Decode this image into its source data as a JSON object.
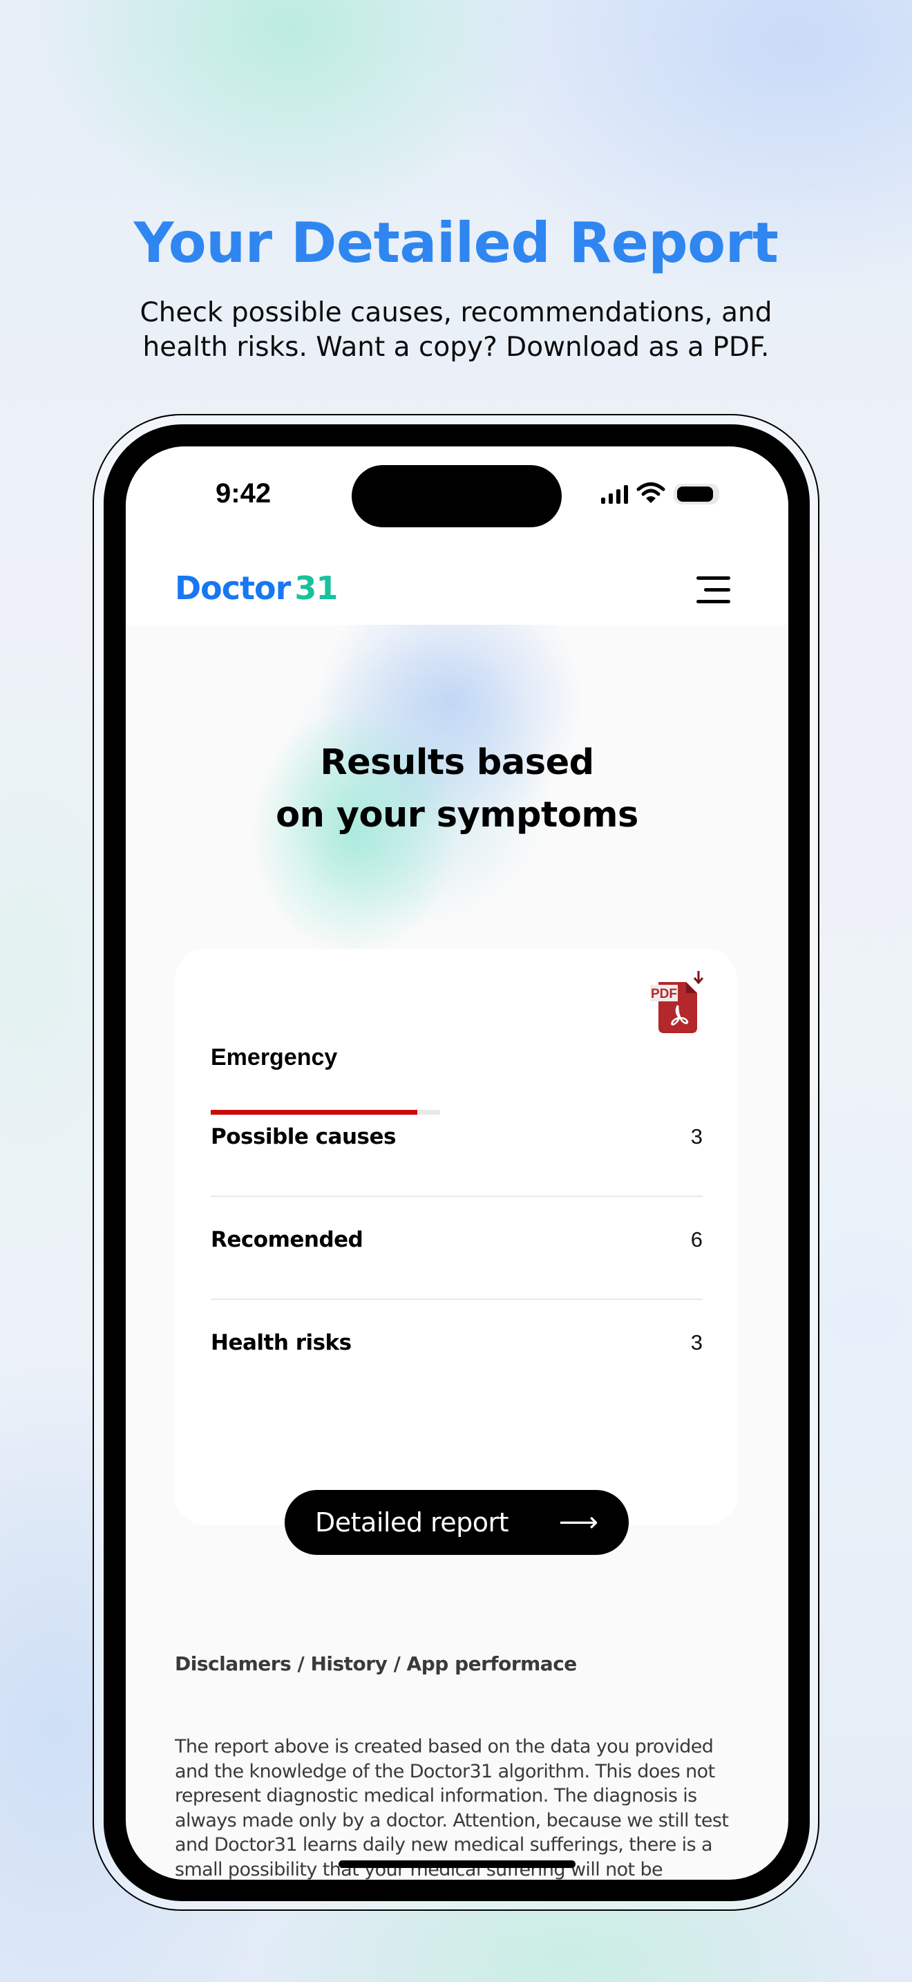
{
  "page": {
    "title": "Your Detailed Report",
    "subtitle_lines": [
      "Check possible causes, recommendations, and",
      "health risks. Want a copy? Download as a PDF."
    ],
    "accent_color": "#2f86f0"
  },
  "status_bar": {
    "time": "9:42",
    "icons": [
      "cellular-signal-icon",
      "wifi-icon",
      "battery-icon"
    ]
  },
  "header": {
    "logo_word": "Doctor",
    "logo_number": "31",
    "logo_colors": {
      "word": "#1877f2",
      "number": "#18c19b"
    },
    "menu_icon": "hamburger-menu-icon"
  },
  "results": {
    "title_lines": [
      "Results based",
      "on your symptoms"
    ]
  },
  "card": {
    "pdf_icon": "pdf-download-icon",
    "pdf_label": "PDF",
    "severity": {
      "label": "Emergency",
      "level_fraction": 0.9,
      "color": "#cc0a0a"
    },
    "rows": [
      {
        "label": "Possible causes",
        "value": "3"
      },
      {
        "label": "Recomended",
        "value": "6"
      },
      {
        "label": "Health risks",
        "value": "3"
      }
    ],
    "cta": {
      "label": "Detailed report",
      "icon": "arrow-right-icon",
      "arrow": "⟶"
    }
  },
  "footer": {
    "links": "Disclamers / History / App performace",
    "disclaimer": "The report above is created based on the data you provided and the knowledge of the Doctor31 algorithm. This does not represent diagnostic medical information. The diagnosis is always made only by a doctor. Attention, because we still test and Doctor31 learns daily new medical sufferings, there is a small possibility that your medical suffering will not be"
  }
}
